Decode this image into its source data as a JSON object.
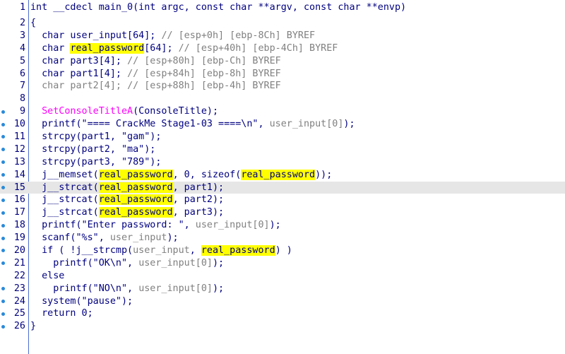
{
  "lines": [
    {
      "no": "1",
      "bp": false,
      "parts": [
        {
          "t": "int __cdecl main_0(int argc, const char **argv, const char **envp)"
        }
      ]
    },
    {
      "no": "2",
      "bp": false,
      "parts": [
        {
          "t": "{"
        }
      ]
    },
    {
      "no": "3",
      "bp": false,
      "parts": [
        {
          "t": "  char user_input[64]; "
        },
        {
          "t": "// [esp+0h] [ebp-8Ch] BYREF",
          "c": "c"
        }
      ]
    },
    {
      "no": "4",
      "bp": false,
      "parts": [
        {
          "t": "  char "
        },
        {
          "t": "real_password",
          "c": "hl"
        },
        {
          "t": "[64]; "
        },
        {
          "t": "// [esp+40h] [ebp-4Ch] BYREF",
          "c": "c"
        }
      ]
    },
    {
      "no": "5",
      "bp": false,
      "parts": [
        {
          "t": "  char part3[4]; "
        },
        {
          "t": "// [esp+80h] [ebp-Ch] BYREF",
          "c": "c"
        }
      ]
    },
    {
      "no": "6",
      "bp": false,
      "parts": [
        {
          "t": "  char part1[4]; "
        },
        {
          "t": "// [esp+84h] [ebp-8h] BYREF",
          "c": "c"
        }
      ]
    },
    {
      "no": "7",
      "bp": false,
      "parts": [
        {
          "t": "  char part2[4]; ",
          "c": "var"
        },
        {
          "t": "// [esp+88h] [ebp-4h] BYREF",
          "c": "c"
        }
      ]
    },
    {
      "no": "8",
      "bp": false,
      "parts": [
        {
          "t": ""
        }
      ]
    },
    {
      "no": "9",
      "bp": true,
      "parts": [
        {
          "t": "  "
        },
        {
          "t": "SetConsoleTitleA",
          "c": "fn"
        },
        {
          "t": "(ConsoleTitle);"
        }
      ]
    },
    {
      "no": "10",
      "bp": true,
      "parts": [
        {
          "t": "  printf(\"==== CrackMe Stage1-03 ====\\n\", "
        },
        {
          "t": "user_input[0]",
          "c": "var"
        },
        {
          "t": ");"
        }
      ]
    },
    {
      "no": "11",
      "bp": true,
      "parts": [
        {
          "t": "  strcpy(part1, \"gam\");"
        }
      ]
    },
    {
      "no": "12",
      "bp": true,
      "parts": [
        {
          "t": "  strcpy(part2, \"ma\");"
        }
      ]
    },
    {
      "no": "13",
      "bp": true,
      "parts": [
        {
          "t": "  strcpy(part3, \"789\");"
        }
      ]
    },
    {
      "no": "14",
      "bp": true,
      "parts": [
        {
          "t": "  j__memset("
        },
        {
          "t": "real_password",
          "c": "hl"
        },
        {
          "t": ", 0, sizeof("
        },
        {
          "t": "real_password",
          "c": "hl"
        },
        {
          "t": "));"
        }
      ]
    },
    {
      "no": "15",
      "bp": true,
      "current": true,
      "parts": [
        {
          "t": "  j__strcat("
        },
        {
          "t": "real_password",
          "c": "hl"
        },
        {
          "t": ", part1);"
        }
      ]
    },
    {
      "no": "16",
      "bp": true,
      "parts": [
        {
          "t": "  j__strcat("
        },
        {
          "t": "real_password",
          "c": "hl"
        },
        {
          "t": ", part2);"
        }
      ]
    },
    {
      "no": "17",
      "bp": true,
      "parts": [
        {
          "t": "  j__strcat("
        },
        {
          "t": "real_password",
          "c": "hl"
        },
        {
          "t": ", part3);"
        }
      ]
    },
    {
      "no": "18",
      "bp": true,
      "parts": [
        {
          "t": "  printf(\"Enter password: \", "
        },
        {
          "t": "user_input[0]",
          "c": "var"
        },
        {
          "t": ");"
        }
      ]
    },
    {
      "no": "19",
      "bp": true,
      "parts": [
        {
          "t": "  scanf(\"%s\", "
        },
        {
          "t": "user_input",
          "c": "var"
        },
        {
          "t": ");"
        }
      ]
    },
    {
      "no": "20",
      "bp": true,
      "parts": [
        {
          "t": "  if ( !j__strcmp("
        },
        {
          "t": "user_input",
          "c": "var"
        },
        {
          "t": ", "
        },
        {
          "t": "real_password",
          "c": "hl"
        },
        {
          "t": ") )"
        }
      ]
    },
    {
      "no": "21",
      "bp": true,
      "parts": [
        {
          "t": "    printf(\"OK\\n\", "
        },
        {
          "t": "user_input[0]",
          "c": "var"
        },
        {
          "t": ");"
        }
      ]
    },
    {
      "no": "22",
      "bp": false,
      "parts": [
        {
          "t": "  else"
        }
      ]
    },
    {
      "no": "23",
      "bp": true,
      "parts": [
        {
          "t": "    printf(\"NO\\n\", "
        },
        {
          "t": "user_input[0]",
          "c": "var"
        },
        {
          "t": ");"
        }
      ]
    },
    {
      "no": "24",
      "bp": true,
      "parts": [
        {
          "t": "  system(\"pause\");"
        }
      ]
    },
    {
      "no": "25",
      "bp": true,
      "parts": [
        {
          "t": "  return 0;"
        }
      ]
    },
    {
      "no": "26",
      "bp": true,
      "parts": [
        {
          "t": "}"
        }
      ]
    }
  ]
}
